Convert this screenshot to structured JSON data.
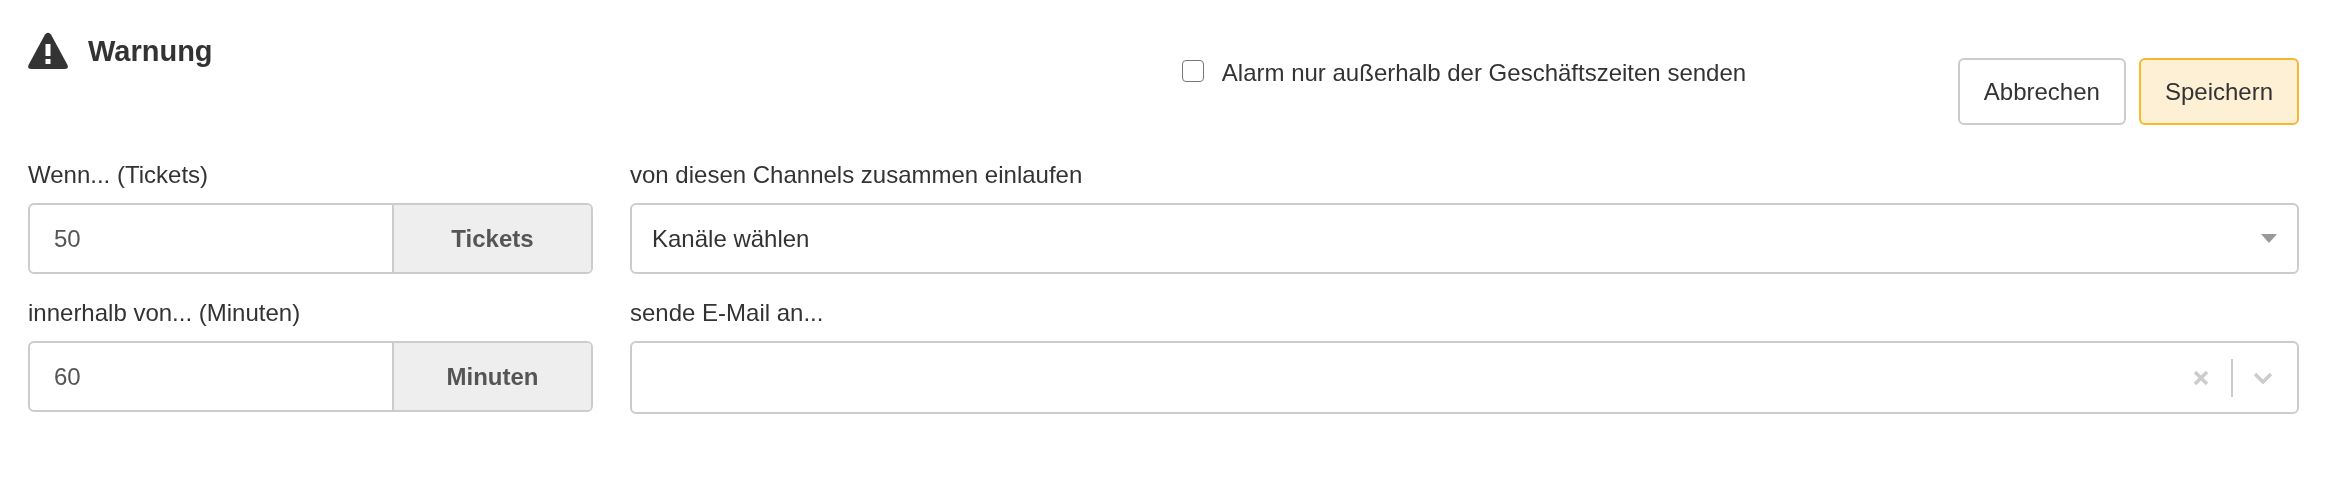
{
  "header": {
    "title": "Warnung"
  },
  "option": {
    "label": "Alarm nur außerhalb der Geschäftszeiten senden",
    "checked": false
  },
  "buttons": [
    {
      "label": "Abbrechen",
      "kind": "default"
    },
    {
      "label": "Speichern",
      "kind": "primary"
    }
  ],
  "fields": [
    {
      "label": "Wenn... (Tickets)",
      "kind": "number",
      "value": "50",
      "unit": "Tickets"
    },
    {
      "label": "von diesen Channels zusammen einlaufen",
      "kind": "select",
      "value": "Kanäle wählen"
    },
    {
      "label": "innerhalb von... (Minuten)",
      "kind": "number",
      "value": "60",
      "unit": "Minuten"
    },
    {
      "label": "sende E-Mail an...",
      "kind": "multiselect"
    }
  ]
}
